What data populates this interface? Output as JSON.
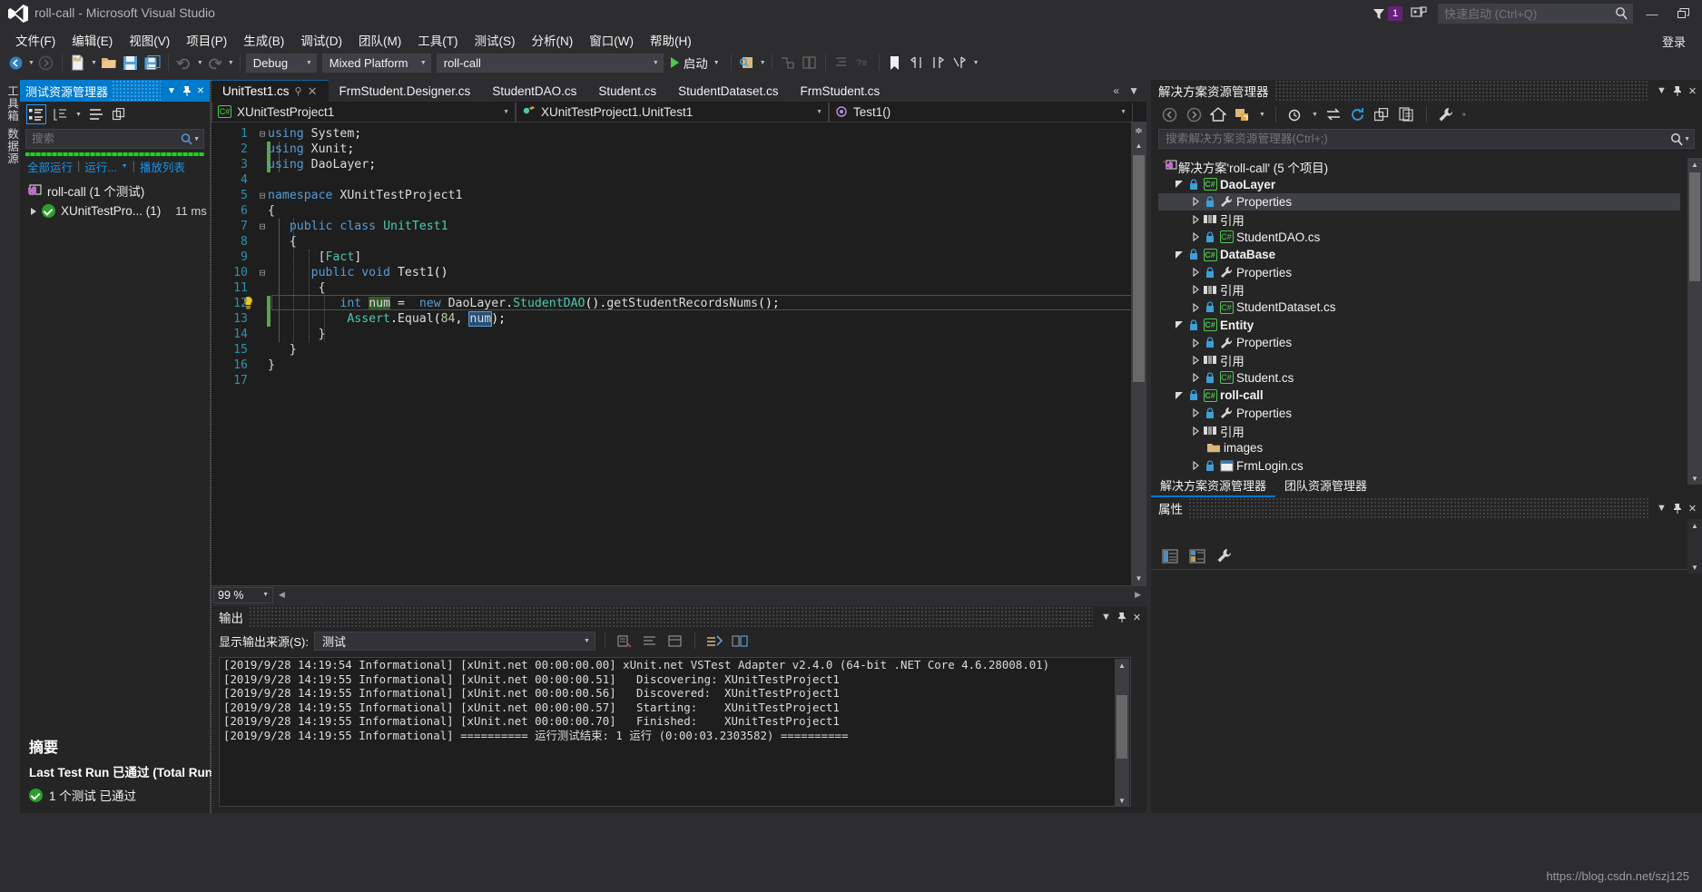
{
  "window": {
    "title": "roll-call - Microsoft Visual Studio",
    "notification_count": "1",
    "quick_launch_placeholder": "快速启动 (Ctrl+Q)",
    "sign_in": "登录",
    "minimize": "—",
    "restore": "❐"
  },
  "menu": [
    {
      "label": "文件(F)"
    },
    {
      "label": "编辑(E)"
    },
    {
      "label": "视图(V)"
    },
    {
      "label": "项目(P)"
    },
    {
      "label": "生成(B)"
    },
    {
      "label": "调试(D)"
    },
    {
      "label": "团队(M)"
    },
    {
      "label": "工具(T)"
    },
    {
      "label": "测试(S)"
    },
    {
      "label": "分析(N)"
    },
    {
      "label": "窗口(W)"
    },
    {
      "label": "帮助(H)"
    }
  ],
  "toolbar": {
    "configuration": "Debug",
    "platform": "Mixed Platform",
    "startup_project": "roll-call",
    "start_label": "启动"
  },
  "dock_strip": [
    "工具箱",
    "数据源"
  ],
  "test_explorer": {
    "title": "测试资源管理器",
    "search_placeholder": "搜索",
    "links": [
      "全部运行",
      "运行...",
      "播放列表"
    ],
    "rows": [
      {
        "label": "roll-call (1 个测试)",
        "duration": "",
        "icon": "vs-project-icon"
      },
      {
        "label": "XUnitTestPro... (1)",
        "duration": "11 ms",
        "icon": "passed-icon"
      }
    ],
    "summary_title": "摘要",
    "summary_line": "Last Test Run 已通过 (Total Run",
    "summary_passed": "1 个测试 已通过"
  },
  "editor": {
    "tabs": [
      {
        "label": "UnitTest1.cs",
        "active": true
      },
      {
        "label": "FrmStudent.Designer.cs",
        "active": false
      },
      {
        "label": "StudentDAO.cs",
        "active": false
      },
      {
        "label": "Student.cs",
        "active": false
      },
      {
        "label": "StudentDataset.cs",
        "active": false
      },
      {
        "label": "FrmStudent.cs",
        "active": false
      }
    ],
    "nav_project": "XUnitTestProject1",
    "nav_type": "XUnitTestProject1.UnitTest1",
    "nav_member": "Test1()",
    "zoom": "99 %",
    "lines": [
      {
        "n": "1",
        "fold": "−",
        "text": "using System;"
      },
      {
        "n": "2",
        "fold": "",
        "text": "using Xunit;"
      },
      {
        "n": "3",
        "fold": "",
        "text": "using DaoLayer;"
      },
      {
        "n": "4",
        "fold": "",
        "text": ""
      },
      {
        "n": "5",
        "fold": "−",
        "text": "namespace XUnitTestProject1"
      },
      {
        "n": "6",
        "fold": "",
        "text": "{"
      },
      {
        "n": "7",
        "fold": "−",
        "text": "    public class UnitTest1"
      },
      {
        "n": "8",
        "fold": "",
        "text": "    {"
      },
      {
        "n": "9",
        "fold": "",
        "text": "        [Fact]"
      },
      {
        "n": "10",
        "fold": "−",
        "text": "        public void Test1()"
      },
      {
        "n": "11",
        "fold": "",
        "text": "        {"
      },
      {
        "n": "12",
        "fold": "",
        "text": "            int num =  new DaoLayer.StudentDAO().getStudentRecordsNums();"
      },
      {
        "n": "13",
        "fold": "",
        "text": "            Assert.Equal(84,  num);"
      },
      {
        "n": "14",
        "fold": "",
        "text": "        }"
      },
      {
        "n": "15",
        "fold": "",
        "text": "    }"
      },
      {
        "n": "16",
        "fold": "",
        "text": "}"
      },
      {
        "n": "17",
        "fold": "",
        "text": ""
      }
    ]
  },
  "output_panel": {
    "title": "输出",
    "source_label": "显示输出来源(S):",
    "source_value": "测试",
    "lines": [
      "[2019/9/28 14:19:54 Informational] [xUnit.net 00:00:00.00] xUnit.net VSTest Adapter v2.4.0 (64-bit .NET Core 4.6.28008.01)",
      "[2019/9/28 14:19:55 Informational] [xUnit.net 00:00:00.51]   Discovering: XUnitTestProject1",
      "[2019/9/28 14:19:55 Informational] [xUnit.net 00:00:00.56]   Discovered:  XUnitTestProject1",
      "[2019/9/28 14:19:55 Informational] [xUnit.net 00:00:00.57]   Starting:    XUnitTestProject1",
      "[2019/9/28 14:19:55 Informational] [xUnit.net 00:00:00.70]   Finished:    XUnitTestProject1",
      "[2019/9/28 14:19:55 Informational] ========== 运行测试结束: 1 运行 (0:00:03.2303582) =========="
    ]
  },
  "solution_explorer": {
    "title": "解决方案资源管理器",
    "search_placeholder": "搜索解决方案资源管理器(Ctrl+;)",
    "tree": [
      {
        "label": "解决方案'roll-call' (5 个项目)",
        "depth": 0,
        "icon": "solution-icon",
        "expander": "none",
        "bold": false,
        "selected": false
      },
      {
        "label": "DaoLayer",
        "depth": 1,
        "icon": "csharp-project-icon",
        "expander": "down",
        "bold": true,
        "selected": false
      },
      {
        "label": "Properties",
        "depth": 2,
        "icon": "wrench-icon",
        "expander": "right",
        "bold": false,
        "selected": true
      },
      {
        "label": "引用",
        "depth": 2,
        "icon": "references-icon",
        "expander": "right",
        "bold": false,
        "selected": false
      },
      {
        "label": "StudentDAO.cs",
        "depth": 2,
        "icon": "csharp-file-icon",
        "expander": "right",
        "bold": false,
        "selected": false
      },
      {
        "label": "DataBase",
        "depth": 1,
        "icon": "csharp-project-icon",
        "expander": "down",
        "bold": true,
        "selected": false
      },
      {
        "label": "Properties",
        "depth": 2,
        "icon": "wrench-icon",
        "expander": "right",
        "bold": false,
        "selected": false
      },
      {
        "label": "引用",
        "depth": 2,
        "icon": "references-icon",
        "expander": "right",
        "bold": false,
        "selected": false
      },
      {
        "label": "StudentDataset.cs",
        "depth": 2,
        "icon": "csharp-file-icon",
        "expander": "right",
        "bold": false,
        "selected": false
      },
      {
        "label": "Entity",
        "depth": 1,
        "icon": "csharp-project-icon",
        "expander": "down",
        "bold": true,
        "selected": false
      },
      {
        "label": "Properties",
        "depth": 2,
        "icon": "wrench-icon",
        "expander": "right",
        "bold": false,
        "selected": false
      },
      {
        "label": "引用",
        "depth": 2,
        "icon": "references-icon",
        "expander": "right",
        "bold": false,
        "selected": false
      },
      {
        "label": "Student.cs",
        "depth": 2,
        "icon": "csharp-file-icon",
        "expander": "right",
        "bold": false,
        "selected": false
      },
      {
        "label": "roll-call",
        "depth": 1,
        "icon": "csharp-project-icon",
        "expander": "down",
        "bold": true,
        "selected": false
      },
      {
        "label": "Properties",
        "depth": 2,
        "icon": "wrench-icon",
        "expander": "right",
        "bold": false,
        "selected": false
      },
      {
        "label": "引用",
        "depth": 2,
        "icon": "references-icon",
        "expander": "right",
        "bold": false,
        "selected": false
      },
      {
        "label": "images",
        "depth": 2,
        "icon": "folder-icon",
        "expander": "none",
        "bold": false,
        "selected": false
      },
      {
        "label": "FrmLogin.cs",
        "depth": 2,
        "icon": "form-icon",
        "expander": "right",
        "bold": false,
        "selected": false
      }
    ],
    "tabs": [
      {
        "label": "解决方案资源管理器",
        "active": true
      },
      {
        "label": "团队资源管理器",
        "active": false
      }
    ]
  },
  "properties_panel": {
    "title": "属性"
  },
  "watermark": "https://blog.csdn.net/szj125"
}
